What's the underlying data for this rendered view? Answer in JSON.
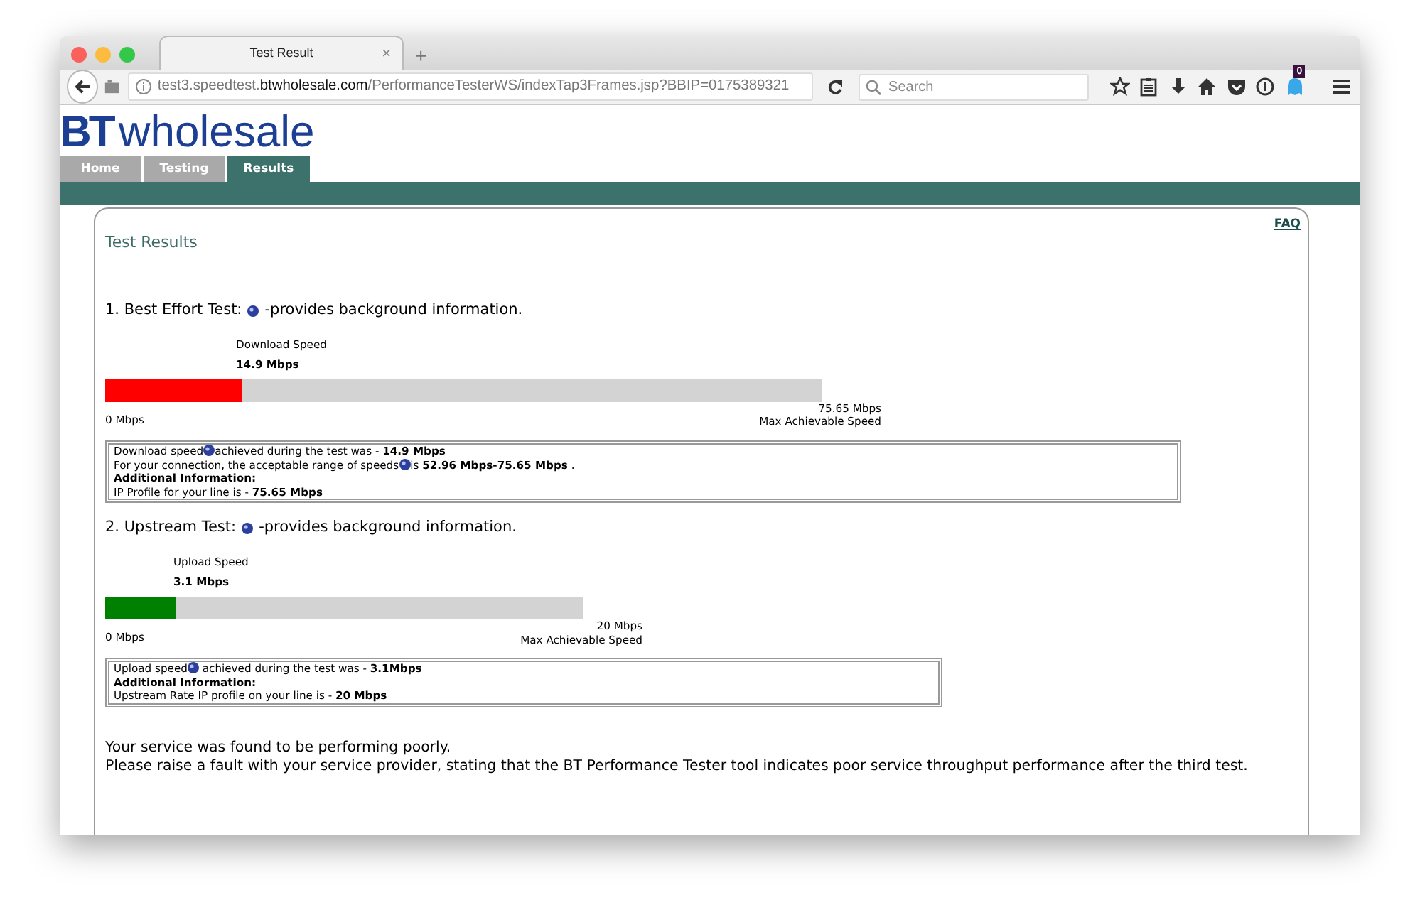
{
  "browser": {
    "tab_title": "Test Result",
    "tab_close": "×",
    "new_tab": "+",
    "url": {
      "prefix": "test3.speedtest.",
      "domain": "btwholesale.com",
      "path": "/PerformanceTesterWS/indexTap3Frames.jsp?BBIP=0175389321"
    },
    "search": {
      "placeholder": "Search"
    },
    "badge": "0"
  },
  "site": {
    "logo": {
      "mark": "BT",
      "word": "wholesale"
    },
    "nav": [
      {
        "label": "Home",
        "selected": false
      },
      {
        "label": "Testing",
        "selected": false
      },
      {
        "label": "Results",
        "selected": true
      }
    ],
    "faq": "FAQ",
    "heading": "Test Results"
  },
  "tests": [
    {
      "title": "1. Best Effort Test:",
      "note": "-provides background information.",
      "gauge_label": "Download Speed",
      "gauge_value": "14.9 Mbps",
      "level": 0.19,
      "color": "#ff0000",
      "min_label": "0 Mbps",
      "max_value": "75.65 Mbps",
      "max_label": "Max Achievable Speed",
      "info": [
        {
          "kind": "help",
          "before": "Download speed",
          "after": "achieved during the test was - **14.9 Mbps**"
        },
        {
          "kind": "help",
          "before": "For your connection, the acceptable range of speeds",
          "after": "is **52.96 Mbps-75.65 Mbps** ."
        },
        {
          "kind": "heading",
          "text": "Additional Information:"
        },
        {
          "kind": "text",
          "text": "IP Profile for your line is - **75.65 Mbps**"
        }
      ]
    },
    {
      "title": "2. Upstream Test:",
      "note": "-provides background information.",
      "gauge_label": "Upload Speed",
      "gauge_value": "3.1 Mbps",
      "level": 0.15,
      "color": "#008000",
      "min_label": "0 Mbps",
      "max_value": "20 Mbps",
      "max_label": "Max Achievable Speed",
      "info": [
        {
          "kind": "help",
          "before": "Upload speed",
          "after": " achieved during the test was - **3.1Mbps**"
        },
        {
          "kind": "heading",
          "text": "Additional Information:"
        },
        {
          "kind": "text",
          "text": "Upstream Rate IP profile on your line is - **20 Mbps**"
        }
      ]
    }
  ],
  "message": [
    "Your service was found to be performing poorly.",
    "Please raise a fault with your service provider, stating that the BT Performance Tester tool indicates poor service throughput performance after the third test."
  ]
}
